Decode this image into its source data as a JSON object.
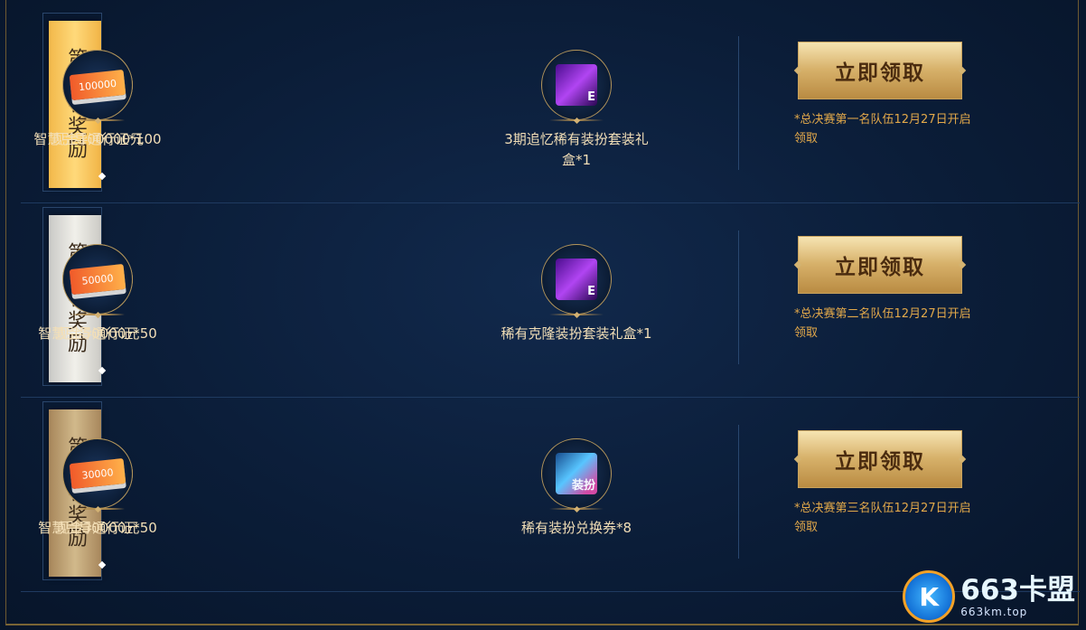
{
  "rows": [
    {
      "rank_label": "第一名奖励",
      "items": [
        {
          "name": "3期追忆稀有装扮套装礼盒*1",
          "tag": "E"
        },
        {
          "name": "智慧引导通行证*100",
          "tag": "E"
        },
        {
          "name": "现金100000元",
          "cash": "100000"
        }
      ],
      "button": "立即领取",
      "note": "*总决赛第一名队伍12月27日开启领取"
    },
    {
      "rank_label": "第二名奖励",
      "items": [
        {
          "name": "稀有克隆装扮套装礼盒*1",
          "tag": "E"
        },
        {
          "name": "智慧引导通行证*50",
          "tag": "E"
        },
        {
          "name": "现金50000元",
          "cash": "50000"
        }
      ],
      "button": "立即领取",
      "note": "*总决赛第二名队伍12月27日开启领取"
    },
    {
      "rank_label": "第三名奖励",
      "items": [
        {
          "name": "稀有装扮兑换券*8",
          "tag": "装扮"
        },
        {
          "name": "智慧引导通行证*50",
          "tag": "E"
        },
        {
          "name": "现金30000元",
          "cash": "30000"
        }
      ],
      "button": "立即领取",
      "note": "*总决赛第三名队伍12月27日开启领取"
    }
  ],
  "logo": {
    "main": "663卡盟",
    "sub": "663km.top"
  }
}
